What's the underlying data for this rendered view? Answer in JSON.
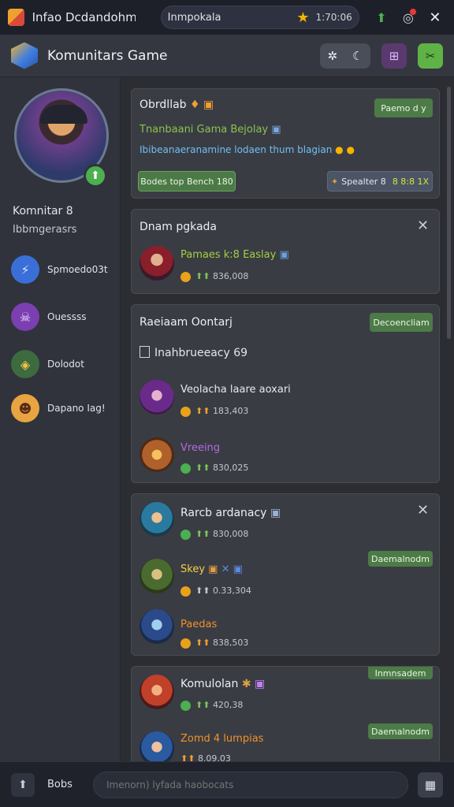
{
  "topbar": {
    "title": "Infao Dcdandohm",
    "search_query": "Inmpokala",
    "search_count": "1:70:06"
  },
  "header": {
    "title": "Komunitars Game"
  },
  "profile": {
    "name": "Komnitar 8",
    "status": "Ibbmgerasrs"
  },
  "nav": [
    {
      "label": "Spmoedo03t",
      "icon": "lightning-icon",
      "color": "#3b6fd8"
    },
    {
      "label": "Ouessss",
      "icon": "skull-icon",
      "color": "#7a3fb0"
    },
    {
      "label": "Dolodot",
      "icon": "shield-icon",
      "color": "#3d6a3e"
    },
    {
      "label": "Dapano Iag!",
      "icon": "hero-icon",
      "color": "#e8a440"
    }
  ],
  "card1": {
    "title": "Obrdllab",
    "badge": "Paemo d y",
    "subtitle": "Tnanbaani Gama Bejolay",
    "line": "Ibibeanaeranamine lodaen thum blagian",
    "btn_left": "Bodes top Bench 180",
    "btn_right_label": "Spealter 8",
    "btn_right_value": "8 8:8 1X"
  },
  "card2": {
    "title": "Dnam pgkada",
    "item": {
      "name": "Pamaes k:8 Easlay",
      "meta": "836,008"
    }
  },
  "card3": {
    "title": "Raeiaam Oontarj",
    "badge": "Decoencliam",
    "subtitle": "Inahbrueeacy 69",
    "items": [
      {
        "name": "Veolacha laare aoxari",
        "meta": "183,403"
      },
      {
        "name": "Vreeing",
        "meta": "830,025"
      }
    ]
  },
  "card4": {
    "items": [
      {
        "name": "Rarcb ardanacy",
        "meta": "830,008"
      },
      {
        "name": "Skey",
        "meta": "0.33,304"
      },
      {
        "name": "Paedas",
        "meta": "838,503"
      }
    ],
    "badge": "Daemalnodm"
  },
  "card5": {
    "badge_top": "Inmnsadem",
    "items": [
      {
        "name": "Komulolan",
        "meta": "420,38"
      },
      {
        "name": "Zomd 4 lumpias",
        "meta": "8.09,03"
      }
    ],
    "badge": "Daemalnodm"
  },
  "bottombar": {
    "label": "Bobs",
    "placeholder": "Imenorn) lyfada haobocats"
  },
  "colors": {
    "accent_green": "#4d7b48",
    "app_bg": "#2b2d33",
    "sidebar_bg": "#30333b",
    "card_bg": "#3a3c44"
  }
}
